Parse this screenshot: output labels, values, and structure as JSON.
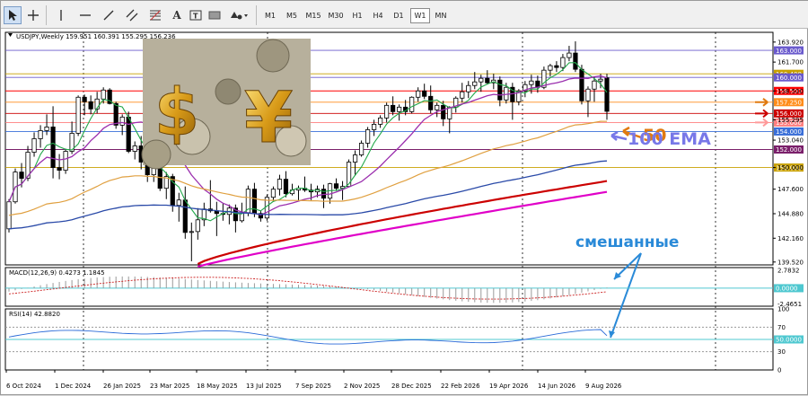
{
  "toolbar": {
    "tools": [
      "cursor-icon",
      "crosshair-icon",
      "vertical-line-icon",
      "horizontal-line-icon",
      "trendline-icon",
      "channel-icon",
      "fibonacci-icon",
      "text-icon",
      "text-label-icon",
      "rectangle-icon",
      "shapes-icon"
    ],
    "timeframes": [
      "M1",
      "M5",
      "M15",
      "M30",
      "H1",
      "H4",
      "D1",
      "W1",
      "MN"
    ],
    "active_timeframe": "W1"
  },
  "chart_data": [
    {
      "type": "candlestick",
      "symbol_label": "USDJPY,Weekly",
      "ohlc_label": "159.951 160.391 155.295 156.236",
      "x_ticks": [
        "6 Oct 2024",
        "1 Dec 2024",
        "26 Jan 2025",
        "23 Mar 2025",
        "18 May 2025",
        "13 Jul 2025",
        "7 Sep 2025",
        "2 Nov 2025",
        "28 Dec 2025",
        "22 Feb 2026",
        "19 Apr 2026",
        "14 Jun 2026",
        "9 Aug 2026"
      ],
      "y_ticks": [
        "163.920",
        "161.700",
        "158.500",
        "155.295",
        "153.040",
        "150.000",
        "147.600",
        "144.880",
        "142.160",
        "139.520"
      ],
      "ylim": [
        139.2,
        165.0
      ],
      "price_levels": [
        {
          "value": "163.000",
          "color": "#6a5acd"
        },
        {
          "value": "160.400",
          "color": "#c8a000"
        },
        {
          "value": "160.000",
          "color": "#6a5acd"
        },
        {
          "value": "158.500",
          "color": "#ff0000"
        },
        {
          "value": "157.250",
          "color": "#ff8c1a"
        },
        {
          "value": "156.000",
          "color": "#cc0000"
        },
        {
          "value": "155.000",
          "color": "#ff7f7f"
        },
        {
          "value": "154.000",
          "color": "#3a6fd8"
        },
        {
          "value": "152.000",
          "color": "#7a1f6a"
        },
        {
          "value": "150.000",
          "color": "#c8a000"
        }
      ],
      "candles": [
        [
          143.2,
          146.5,
          142.8,
          146.2
        ],
        [
          146.2,
          149.9,
          146.0,
          149.5
        ],
        [
          149.5,
          150.5,
          147.8,
          148.8
        ],
        [
          148.8,
          152.4,
          148.5,
          151.7
        ],
        [
          151.7,
          153.9,
          151.2,
          153.2
        ],
        [
          153.2,
          154.7,
          152.2,
          154.1
        ],
        [
          154.1,
          155.9,
          153.6,
          154.5
        ],
        [
          154.5,
          156.8,
          148.8,
          150.0
        ],
        [
          150.0,
          151.5,
          148.7,
          149.7
        ],
        [
          149.7,
          152.1,
          149.3,
          151.8
        ],
        [
          151.8,
          155.1,
          151.5,
          153.8
        ],
        [
          153.8,
          158.0,
          153.5,
          157.8
        ],
        [
          157.8,
          158.1,
          155.8,
          157.3
        ],
        [
          157.3,
          158.0,
          155.9,
          156.5
        ],
        [
          156.5,
          158.4,
          156.0,
          157.6
        ],
        [
          157.6,
          158.9,
          157.1,
          158.6
        ],
        [
          158.6,
          158.8,
          157.0,
          157.1
        ],
        [
          157.1,
          157.3,
          154.3,
          154.7
        ],
        [
          154.7,
          155.9,
          153.6,
          155.6
        ],
        [
          155.6,
          156.2,
          151.6,
          151.8
        ],
        [
          151.8,
          152.9,
          150.9,
          152.4
        ],
        [
          152.4,
          153.5,
          149.8,
          150.6
        ],
        [
          150.6,
          151.2,
          148.4,
          149.2
        ],
        [
          149.2,
          150.9,
          148.4,
          150.3
        ],
        [
          150.3,
          151.1,
          147.4,
          147.7
        ],
        [
          147.7,
          149.5,
          146.5,
          149.0
        ],
        [
          149.0,
          149.3,
          145.1,
          145.8
        ],
        [
          145.8,
          147.2,
          144.0,
          146.4
        ],
        [
          146.4,
          147.9,
          142.1,
          142.8
        ],
        [
          142.8,
          143.9,
          139.6,
          142.9
        ],
        [
          142.9,
          145.5,
          142.0,
          144.2
        ],
        [
          144.2,
          146.1,
          143.5,
          145.4
        ],
        [
          145.4,
          148.6,
          145.0,
          145.2
        ],
        [
          145.2,
          146.2,
          142.4,
          144.9
        ],
        [
          144.9,
          146.0,
          144.1,
          144.8
        ],
        [
          144.8,
          145.9,
          143.7,
          145.5
        ],
        [
          145.5,
          145.9,
          142.8,
          144.1
        ],
        [
          144.1,
          146.1,
          143.9,
          145.0
        ],
        [
          145.0,
          148.0,
          144.6,
          147.6
        ],
        [
          147.6,
          148.3,
          144.5,
          144.9
        ],
        [
          144.9,
          145.2,
          144.0,
          144.4
        ],
        [
          144.4,
          147.0,
          144.1,
          146.7
        ],
        [
          146.7,
          147.9,
          146.2,
          147.6
        ],
        [
          147.6,
          149.2,
          146.9,
          148.7
        ],
        [
          148.7,
          149.6,
          146.7,
          147.1
        ],
        [
          147.1,
          148.2,
          146.9,
          147.5
        ],
        [
          147.5,
          148.0,
          146.3,
          147.7
        ],
        [
          147.7,
          149.0,
          147.3,
          147.5
        ],
        [
          147.5,
          148.2,
          146.4,
          147.3
        ],
        [
          147.3,
          148.0,
          146.7,
          147.6
        ],
        [
          147.6,
          148.1,
          145.5,
          146.6
        ],
        [
          146.6,
          148.3,
          146.0,
          148.2
        ],
        [
          148.2,
          148.8,
          147.4,
          147.7
        ],
        [
          147.7,
          148.5,
          146.4,
          147.9
        ],
        [
          147.9,
          150.9,
          147.8,
          150.6
        ],
        [
          150.6,
          151.9,
          149.1,
          151.4
        ],
        [
          151.4,
          153.0,
          151.2,
          152.7
        ],
        [
          152.7,
          154.5,
          152.2,
          154.2
        ],
        [
          154.2,
          155.3,
          153.5,
          154.8
        ],
        [
          154.8,
          155.8,
          154.4,
          155.5
        ],
        [
          155.5,
          157.2,
          155.0,
          156.9
        ],
        [
          156.9,
          157.9,
          155.8,
          156.2
        ],
        [
          156.2,
          157.0,
          155.2,
          156.7
        ],
        [
          156.7,
          157.5,
          155.8,
          156.2
        ],
        [
          156.2,
          157.9,
          156.0,
          157.8
        ],
        [
          157.8,
          158.9,
          157.3,
          158.5
        ],
        [
          158.5,
          159.3,
          157.6,
          157.9
        ],
        [
          157.9,
          159.1,
          156.0,
          156.4
        ],
        [
          156.4,
          157.2,
          155.6,
          156.9
        ],
        [
          156.9,
          157.4,
          154.6,
          155.4
        ],
        [
          155.4,
          156.8,
          153.8,
          156.7
        ],
        [
          156.7,
          157.9,
          156.1,
          157.7
        ],
        [
          157.7,
          159.4,
          157.2,
          158.4
        ],
        [
          158.4,
          159.6,
          157.7,
          159.1
        ],
        [
          159.1,
          160.6,
          158.7,
          159.5
        ],
        [
          159.5,
          160.3,
          158.4,
          159.9
        ],
        [
          159.9,
          160.8,
          159.2,
          159.4
        ],
        [
          159.4,
          160.4,
          158.7,
          159.7
        ],
        [
          159.7,
          160.1,
          156.8,
          157.5
        ],
        [
          157.5,
          159.4,
          157.1,
          158.9
        ],
        [
          158.9,
          159.4,
          155.3,
          157.3
        ],
        [
          157.3,
          158.7,
          156.9,
          158.5
        ],
        [
          158.5,
          159.6,
          157.8,
          159.2
        ],
        [
          159.2,
          160.3,
          158.2,
          159.6
        ],
        [
          159.6,
          160.2,
          158.3,
          158.9
        ],
        [
          158.9,
          161.2,
          158.7,
          160.8
        ],
        [
          160.8,
          161.5,
          160.1,
          161.3
        ],
        [
          161.3,
          161.8,
          160.6,
          161.1
        ],
        [
          161.1,
          162.6,
          160.7,
          162.2
        ],
        [
          162.2,
          163.5,
          161.8,
          162.7
        ],
        [
          162.7,
          164.0,
          160.6,
          160.9
        ],
        [
          160.9,
          161.4,
          157.0,
          157.4
        ],
        [
          157.4,
          159.0,
          155.6,
          158.7
        ],
        [
          158.7,
          160.1,
          157.3,
          159.6
        ],
        [
          159.6,
          160.4,
          158.8,
          159.8
        ],
        [
          159.95,
          160.391,
          155.295,
          156.236
        ]
      ],
      "moving_averages": [
        {
          "name": "",
          "color": "#22a84a"
        },
        {
          "name": "",
          "color": "#9b2fae"
        },
        {
          "name": "",
          "color": "#e0a040"
        },
        {
          "name": "",
          "color": "#2a4aa8"
        },
        {
          "name": "",
          "color": "#cc0000"
        },
        {
          "name": "",
          "color": "#e000c8"
        }
      ],
      "annotations": [
        {
          "text": "50",
          "color": "#e07a10"
        },
        {
          "text": "100 EMA",
          "color": "#7878e8"
        },
        {
          "text": "смешанные",
          "color": "#2a8ad8"
        }
      ]
    },
    {
      "type": "macd",
      "label": "MACD(12,26,9) 0.4273 1.1845",
      "y_ticks": [
        "2.7832",
        "0.0000",
        "-2.4651"
      ],
      "ylim": [
        -2.8,
        3.2
      ],
      "zero_tag": "0.0000"
    },
    {
      "type": "rsi",
      "label": "RSI(14) 42.8820",
      "y_ticks": [
        "100",
        "70",
        "50.0000",
        "30",
        "0"
      ],
      "ylim": [
        0,
        100
      ],
      "mid_tag": "50.0000"
    }
  ]
}
